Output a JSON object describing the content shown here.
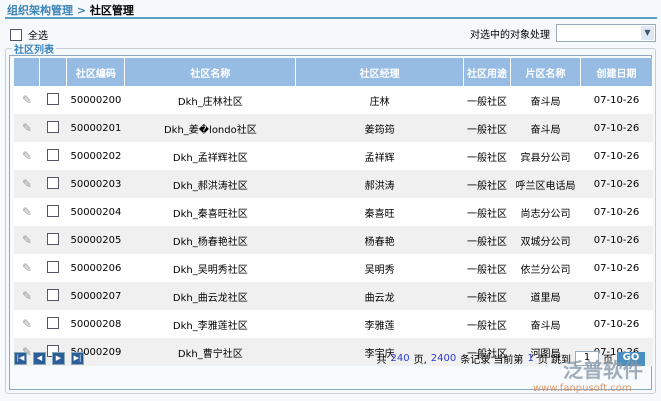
{
  "breadcrumb": {
    "parent": "组织架构管理",
    "sep": " > ",
    "current": "社区管理"
  },
  "select_all": "全选",
  "action": {
    "label": "对选中的对象处理",
    "value": ""
  },
  "legend": "社区列表",
  "columns": [
    "社区编码",
    "社区名称",
    "社区经理",
    "社区用途",
    "片区名称",
    "创建日期"
  ],
  "rows": [
    [
      "50000200",
      "Dkh_庄林社区",
      "庄林",
      "一般社区",
      "奋斗局",
      "07-10-26"
    ],
    [
      "50000201",
      "Dkh_姜�londo社区",
      "姜筠筠",
      "一般社区",
      "奋斗局",
      "07-10-26"
    ],
    [
      "50000202",
      "Dkh_孟祥辉社区",
      "孟祥辉",
      "一般社区",
      "宾县分公司",
      "07-10-26"
    ],
    [
      "50000203",
      "Dkh_郝洪涛社区",
      "郝洪涛",
      "一般社区",
      "呼兰区电话局",
      "07-10-26"
    ],
    [
      "50000204",
      "Dkh_秦喜旺社区",
      "秦喜旺",
      "一般社区",
      "尚志分公司",
      "07-10-26"
    ],
    [
      "50000205",
      "Dkh_杨春艳社区",
      "杨春艳",
      "一般社区",
      "双城分公司",
      "07-10-26"
    ],
    [
      "50000206",
      "Dkh_吴明秀社区",
      "吴明秀",
      "一般社区",
      "依兰分公司",
      "07-10-26"
    ],
    [
      "50000207",
      "Dkh_曲云龙社区",
      "曲云龙",
      "一般社区",
      "道里局",
      "07-10-26"
    ],
    [
      "50000208",
      "Dkh_李雅莲社区",
      "李雅莲",
      "一般社区",
      "奋斗局",
      "07-10-26"
    ],
    [
      "50000209",
      "Dkh_曹宁社区",
      "李宇庆",
      "一般社区",
      "河图局",
      "07-10-26"
    ]
  ],
  "pager": {
    "t1": "共",
    "pages": "240",
    "t2": "页,",
    "records": "2400",
    "t3": "条记录  当前第",
    "current": "1",
    "t4": "页 跳到",
    "jump": "1",
    "t5": "页",
    "go": "GO"
  },
  "watermark": {
    "name": "泛普软件",
    "url": "www.fanpusoft.com"
  }
}
